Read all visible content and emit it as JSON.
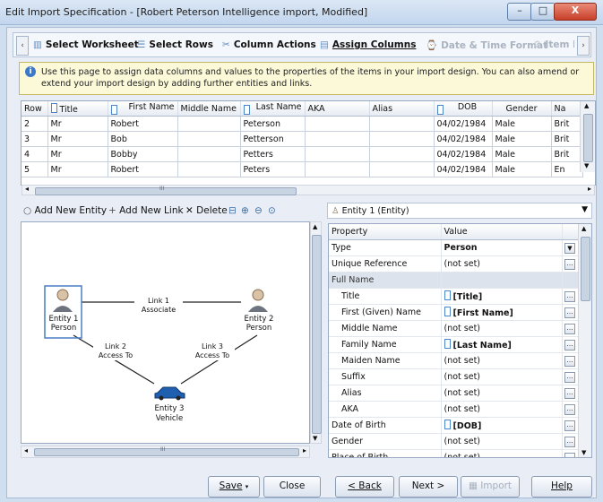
{
  "window": {
    "title": "Edit Import Specification - [Robert Peterson Intelligence import, Modified]",
    "min_glyph": "–",
    "max_glyph": "□",
    "close_glyph": "X"
  },
  "steps": [
    {
      "label": "Select Worksheet",
      "state": "enabled"
    },
    {
      "label": "Select Rows",
      "state": "enabled"
    },
    {
      "label": "Column Actions",
      "state": "enabled"
    },
    {
      "label": "Assign Columns",
      "state": "active"
    },
    {
      "label": "Date & Time Format",
      "state": "disabled"
    },
    {
      "label": "Item M",
      "state": "disabled"
    }
  ],
  "info": {
    "text": "Use this page to assign data columns and values to the properties of the items in your import design. You can also amend or extend your import design by adding further entities and links."
  },
  "grid": {
    "columns": [
      "Row",
      "Title",
      "First Name",
      "Middle Name",
      "Last Name",
      "AKA",
      "Alias",
      "DOB",
      "Gender",
      "Na"
    ],
    "rows": [
      [
        "2",
        "Mr",
        "Robert",
        "",
        "Peterson",
        "",
        "",
        "04/02/1984",
        "Male",
        "Brit"
      ],
      [
        "3",
        "Mr",
        "Bob",
        "",
        "Petterson",
        "",
        "",
        "04/02/1984",
        "Male",
        "Brit"
      ],
      [
        "4",
        "Mr",
        "Bobby",
        "",
        "Petters",
        "",
        "",
        "04/02/1984",
        "Male",
        "Brit"
      ],
      [
        "5",
        "Mr",
        "Robert",
        "",
        "Peters",
        "",
        "",
        "04/02/1984",
        "Male",
        "En"
      ]
    ],
    "hscroll_label": "III"
  },
  "left_toolbar": {
    "add_entity": "Add New Entity",
    "add_link": "Add New Link",
    "delete": "Delete"
  },
  "diagram": {
    "entities": [
      {
        "name": "Entity 1",
        "type": "Person"
      },
      {
        "name": "Entity 2",
        "type": "Person"
      },
      {
        "name": "Entity 3",
        "type": "Vehicle"
      }
    ],
    "links": [
      {
        "name": "Link 1",
        "type": "Associate"
      },
      {
        "name": "Link 2",
        "type": "Access To"
      },
      {
        "name": "Link 3",
        "type": "Access To"
      }
    ],
    "hscroll_label": "III"
  },
  "entity_selector": {
    "value": "Entity 1 (Entity)"
  },
  "properties": {
    "header_property": "Property",
    "header_value": "Value",
    "rows": [
      {
        "property": "Type",
        "value": "Person",
        "kind": "bold",
        "button": "dropdown"
      },
      {
        "property": "Unique Reference",
        "value": "(not set)",
        "kind": "plain",
        "button": "ellipsis"
      },
      {
        "property": "Full Name",
        "value": "",
        "kind": "group",
        "button": "none"
      },
      {
        "property": "Title",
        "value": "[Title]",
        "kind": "column",
        "indent": true,
        "button": "ellipsis"
      },
      {
        "property": "First (Given) Name",
        "value": "[First Name]",
        "kind": "column",
        "indent": true,
        "button": "ellipsis"
      },
      {
        "property": "Middle Name",
        "value": "(not set)",
        "kind": "plain",
        "indent": true,
        "button": "ellipsis"
      },
      {
        "property": "Family Name",
        "value": "[Last Name]",
        "kind": "column",
        "indent": true,
        "button": "ellipsis"
      },
      {
        "property": "Maiden Name",
        "value": "(not set)",
        "kind": "plain",
        "indent": true,
        "button": "ellipsis"
      },
      {
        "property": "Suffix",
        "value": "(not set)",
        "kind": "plain",
        "indent": true,
        "button": "ellipsis"
      },
      {
        "property": "Alias",
        "value": "(not set)",
        "kind": "plain",
        "indent": true,
        "button": "ellipsis"
      },
      {
        "property": "AKA",
        "value": "(not set)",
        "kind": "plain",
        "indent": true,
        "button": "ellipsis"
      },
      {
        "property": "Date of Birth",
        "value": "[DOB]",
        "kind": "column",
        "button": "ellipsis"
      },
      {
        "property": "Gender",
        "value": "(not set)",
        "kind": "plain",
        "button": "ellipsis"
      },
      {
        "property": "Place of Birth",
        "value": "(not set)",
        "kind": "plain",
        "button": "ellipsis"
      }
    ]
  },
  "buttons": {
    "save": "Save",
    "close": "Close",
    "back": "< Back",
    "next": "Next >",
    "import": "Import",
    "help": "Help"
  }
}
